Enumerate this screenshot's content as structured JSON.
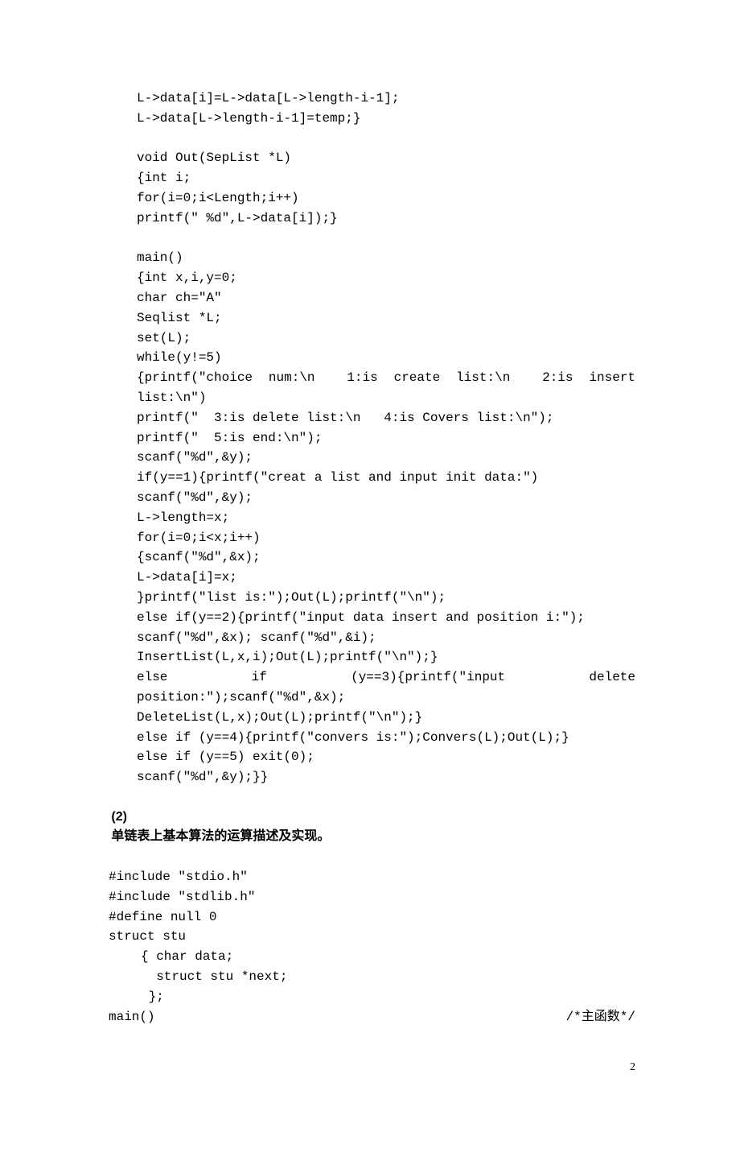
{
  "code_1": "L->data[i]=L->data[L->length-i-1];\nL->data[L->length-i-1]=temp;}\n\nvoid Out(SepList *L)\n{int i;\nfor(i=0;i<Length;i++)\nprintf(\" %d\",L->data[i]);}\n\nmain()\n{int x,i,y=0;\nchar ch=\"A\"\nSeqlist *L;\nset(L);\nwhile(y!=5)\n{printf(\"choice num:\\n  1:is create list:\\n  2:is insert list:\\n\")\nprintf(\"  3:is delete list:\\n   4:is Covers list:\\n\");\nprintf(\"  5:is end:\\n\");\nscanf(\"%d\",&y);\nif(y==1){printf(\"creat a list and input init data:\")\nscanf(\"%d\",&y);\nL->length=x;\nfor(i=0;i<x;i++)\n{scanf(\"%d\",&x);\nL->data[i]=x;\n}printf(\"list is:\");Out(L);printf(\"\\n\");\nelse if(y==2){printf(\"input data insert and position i:\");\nscanf(\"%d\",&x); scanf(\"%d\",&i);\nInsertList(L,x,i);Out(L);printf(\"\\n\");}\nelse     if     (y==3){printf(\"input     delete position:\");scanf(\"%d\",&x);\nDeleteList(L,x);Out(L);printf(\"\\n\");}\nelse if (y==4){printf(\"convers is:\");Convers(L);Out(L);}\nelse if (y==5) exit(0);\nscanf(\"%d\",&y);}}",
  "heading_number": "(2)",
  "heading_text": "单链表上基本算法的运算描述及实现。",
  "code_2": "#include \"stdio.h\"\n#include \"stdlib.h\"\n#define null 0\nstruct stu",
  "code_3": "{ char data;\n  struct stu *next;\n };",
  "main_left": "main()",
  "main_right": "/*主函数*/",
  "page_number": "2"
}
